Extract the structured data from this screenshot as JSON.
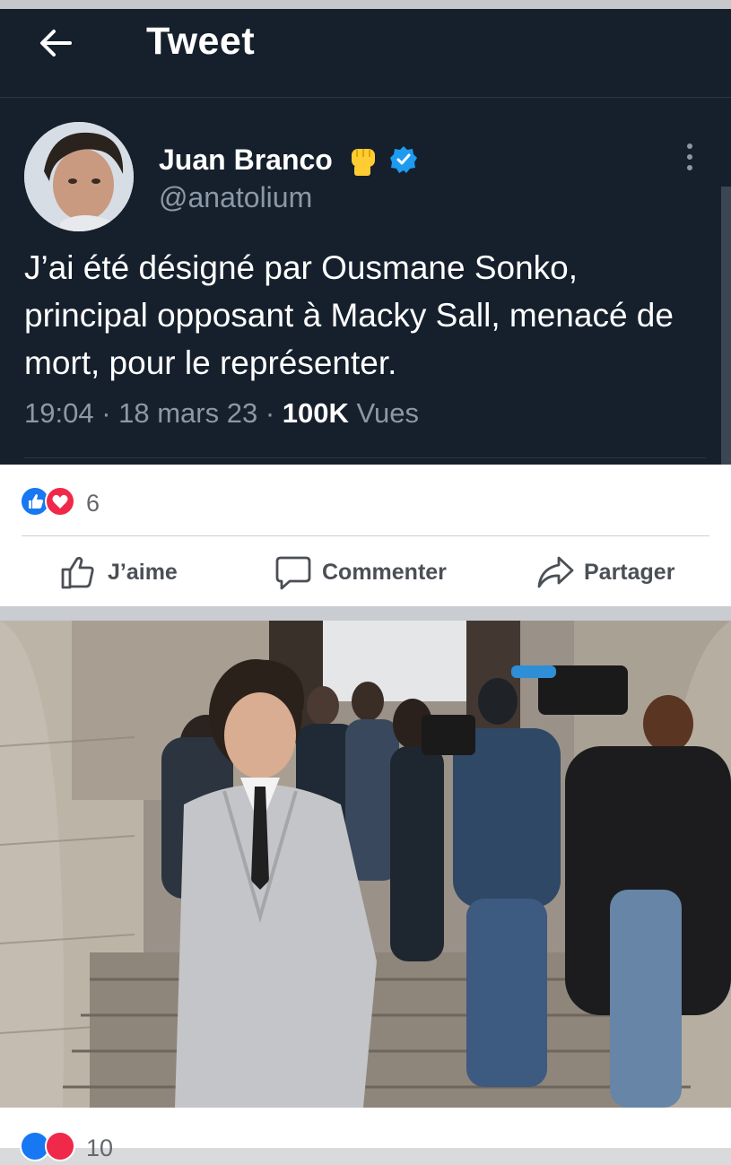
{
  "tweet": {
    "header_title": "Tweet",
    "author_name": "Juan Branco",
    "author_handle": "@anatolium",
    "text": "J’ai été désigné par Ousmane Sonko, principal opposant à Macky Sall, menacé de mort, pour le représenter.",
    "time": "19:04",
    "sep1": " · ",
    "date": "18 mars 23",
    "sep2": " · ",
    "views_count": "100K",
    "views_label": " Vues",
    "icons": [
      "back-arrow-icon",
      "raised-fist-icon",
      "verified-badge-icon",
      "more-vertical-icon"
    ]
  },
  "post": {
    "reaction_count": "6",
    "actions": {
      "like_label": "J’aime",
      "comment_label": "Commenter",
      "share_label": "Partager"
    },
    "icons": [
      "like-reaction-icon",
      "love-reaction-icon",
      "thumbs-up-icon",
      "comment-bubble-icon",
      "share-arrow-icon"
    ]
  },
  "post2": {
    "reaction_count": "10"
  },
  "colors": {
    "tweet_bg": "#16202c",
    "fb_blue": "#1877f2",
    "fb_red": "#f02849",
    "verified_blue": "#1d9bf0",
    "fist_yellow": "#ffcc33"
  }
}
